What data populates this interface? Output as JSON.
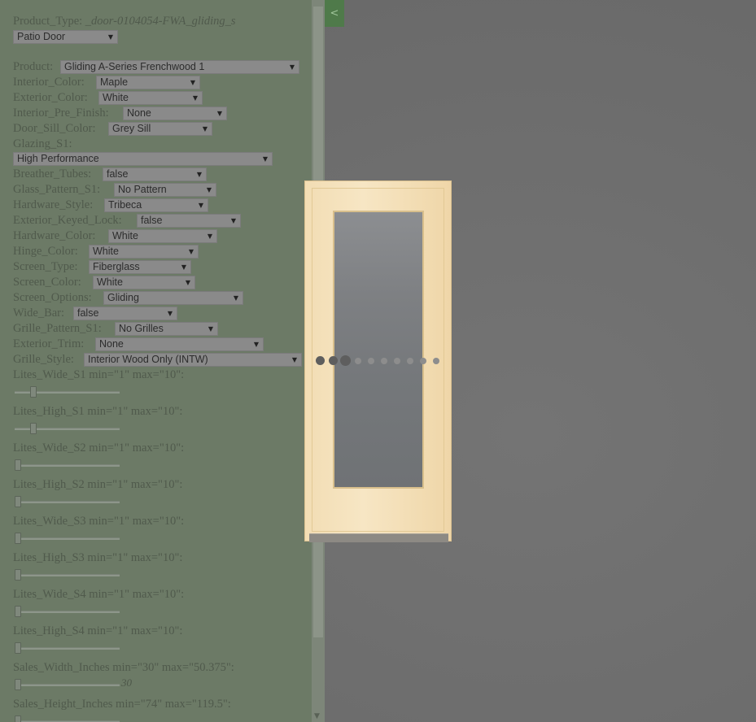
{
  "toggle_label": "<",
  "product_type": {
    "label": "Product_Type: ",
    "value": "_door-0104054-FWA_gliding_s"
  },
  "category_select": "Patio Door",
  "fields": [
    {
      "label": "Product:",
      "value": "Gliding A-Series Frenchwood 1"
    },
    {
      "label": "Interior_Color:",
      "value": "Maple"
    },
    {
      "label": "Exterior_Color:",
      "value": "White"
    },
    {
      "label": "Interior_Pre_Finish:",
      "value": "None"
    },
    {
      "label": "Door_Sill_Color:",
      "value": "Grey Sill"
    },
    {
      "label": "Glazing_S1:",
      "value": "High Performance"
    },
    {
      "label": "Breather_Tubes:",
      "value": "false"
    },
    {
      "label": "Glass_Pattern_S1:",
      "value": "No Pattern"
    },
    {
      "label": "Hardware_Style:",
      "value": "Tribeca"
    },
    {
      "label": "Exterior_Keyed_Lock:",
      "value": "false"
    },
    {
      "label": "Hardware_Color:",
      "value": "White"
    },
    {
      "label": "Hinge_Color:",
      "value": "White"
    },
    {
      "label": "Screen_Type:",
      "value": "Fiberglass"
    },
    {
      "label": "Screen_Color:",
      "value": "White"
    },
    {
      "label": "Screen_Options:",
      "value": "Gliding"
    },
    {
      "label": "Wide_Bar:",
      "value": "false"
    },
    {
      "label": "Grille_Pattern_S1:",
      "value": "No Grilles"
    },
    {
      "label": "Exterior_Trim:",
      "value": "None"
    },
    {
      "label": "Grille_Style:",
      "value": "Interior Wood Only (INTW)"
    }
  ],
  "sliders": [
    {
      "label": "Lites_Wide_S1 min=\"1\" max=\"10\":",
      "min": 1,
      "max": 10,
      "value": 2
    },
    {
      "label": "Lites_High_S1 min=\"1\" max=\"10\":",
      "min": 1,
      "max": 10,
      "value": 2
    },
    {
      "label": "Lites_Wide_S2 min=\"1\" max=\"10\":",
      "min": 1,
      "max": 10,
      "value": 1
    },
    {
      "label": "Lites_High_S2 min=\"1\" max=\"10\":",
      "min": 1,
      "max": 10,
      "value": 1
    },
    {
      "label": "Lites_Wide_S3 min=\"1\" max=\"10\":",
      "min": 1,
      "max": 10,
      "value": 1
    },
    {
      "label": "Lites_High_S3 min=\"1\" max=\"10\":",
      "min": 1,
      "max": 10,
      "value": 1
    },
    {
      "label": "Lites_Wide_S4 min=\"1\" max=\"10\":",
      "min": 1,
      "max": 10,
      "value": 1
    },
    {
      "label": "Lites_High_S4 min=\"1\" max=\"10\":",
      "min": 1,
      "max": 10,
      "value": 1
    },
    {
      "label": "Sales_Width_Inches min=\"30\" max=\"50.375\":",
      "min": 30,
      "max": 50.375,
      "value": 30,
      "value_text": "30"
    },
    {
      "label": "Sales_Height_Inches min=\"74\" max=\"119.5\":",
      "min": 74,
      "max": 119.5,
      "value": 74
    }
  ],
  "loading_dots": 10
}
